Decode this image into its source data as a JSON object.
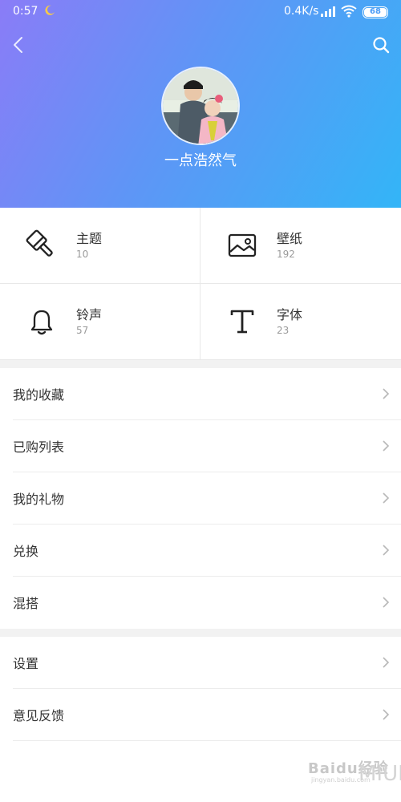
{
  "status_bar": {
    "time": "0:57",
    "net_speed": "0.4K/s",
    "battery": "68"
  },
  "header": {
    "username": "一点浩然气"
  },
  "grid": [
    {
      "label": "主题",
      "count": "10",
      "icon": "brush-icon"
    },
    {
      "label": "壁纸",
      "count": "192",
      "icon": "image-icon"
    },
    {
      "label": "铃声",
      "count": "57",
      "icon": "bell-icon"
    },
    {
      "label": "字体",
      "count": "23",
      "icon": "font-icon"
    }
  ],
  "list_primary": [
    {
      "label": "我的收藏"
    },
    {
      "label": "已购列表"
    },
    {
      "label": "我的礼物"
    },
    {
      "label": "兑换"
    },
    {
      "label": "混搭"
    }
  ],
  "list_secondary": [
    {
      "label": "设置"
    },
    {
      "label": "意见反馈"
    }
  ],
  "watermark": {
    "brand": "Baidu经验",
    "url": "jingyan.baidu.com",
    "mui": "MIUI"
  },
  "colors": {
    "header_gradient_start": "#8a7cf7",
    "header_gradient_end": "#33b5f7",
    "separator": "#f2f2f2"
  }
}
